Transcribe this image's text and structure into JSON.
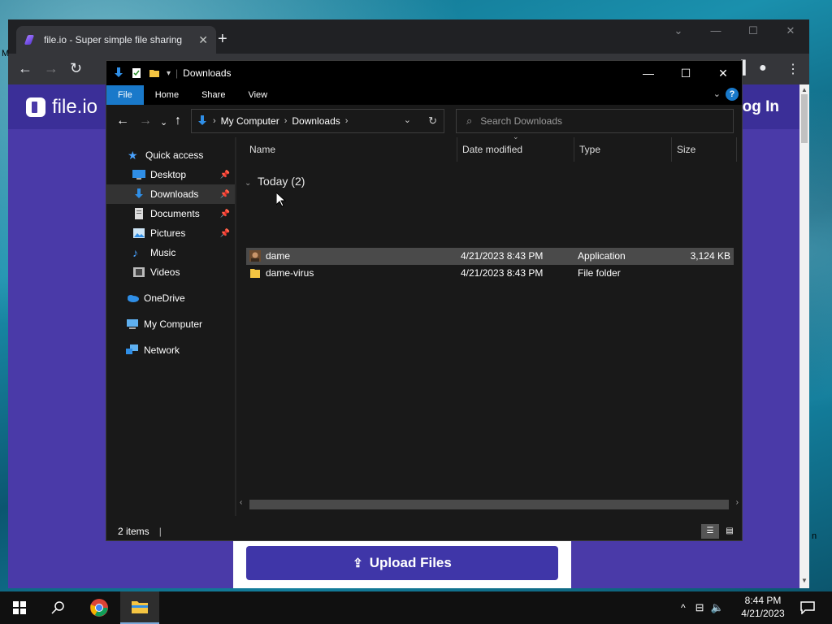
{
  "browser": {
    "tab_title": "file.io - Super simple file sharing",
    "tab_close": "✕",
    "new_tab": "+",
    "page": {
      "logo_text": "file.io",
      "login_label": "Log In",
      "upload_label": "Upload Files",
      "stray_left": "M",
      "stray_right": "n"
    }
  },
  "explorer": {
    "title": "Downloads",
    "ribbon_tabs": [
      "File",
      "Home",
      "Share",
      "View"
    ],
    "help": "?",
    "breadcrumb": [
      "My Computer",
      "Downloads"
    ],
    "search_placeholder": "Search Downloads",
    "nav": {
      "quick_access": "Quick access",
      "desktop": "Desktop",
      "downloads": "Downloads",
      "documents": "Documents",
      "pictures": "Pictures",
      "music": "Music",
      "videos": "Videos",
      "onedrive": "OneDrive",
      "my_computer": "My Computer",
      "network": "Network"
    },
    "columns": {
      "name": "Name",
      "date": "Date modified",
      "type": "Type",
      "size": "Size"
    },
    "group_label": "Today (2)",
    "files": [
      {
        "name": "dame",
        "date": "4/21/2023 8:43 PM",
        "type": "Application",
        "size": "3,124 KB",
        "icon": "application-icon"
      },
      {
        "name": "dame-virus",
        "date": "4/21/2023 8:43 PM",
        "type": "File folder",
        "size": "",
        "icon": "folder-icon"
      }
    ],
    "status": "2 items"
  },
  "taskbar": {
    "clock_time": "8:44 PM",
    "clock_date": "4/21/2023"
  },
  "colors": {
    "accent": "#1979ca",
    "page_purple": "#4a3aa8",
    "button_purple": "#3f36a8"
  }
}
